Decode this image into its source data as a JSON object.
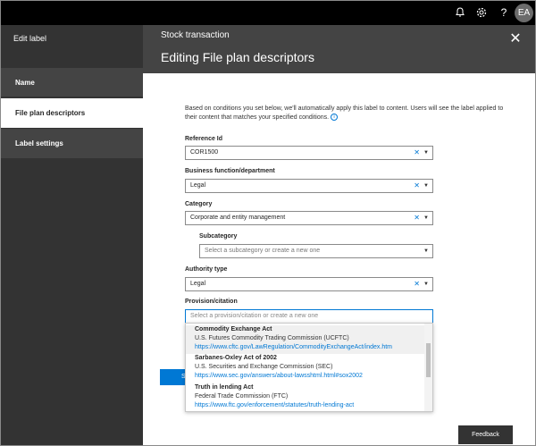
{
  "topbar": {
    "icons": [
      "bell-icon",
      "gear-icon",
      "help-icon"
    ],
    "help_glyph": "?",
    "avatar_initials": "EA"
  },
  "leftnav": {
    "title": "Edit label",
    "items": [
      {
        "label": "Name",
        "active": false
      },
      {
        "label": "File plan descriptors",
        "active": true
      },
      {
        "label": "Label settings",
        "active": false
      }
    ]
  },
  "header": {
    "subtitle": "Stock transaction",
    "title": "Editing File plan descriptors"
  },
  "description": "Based on conditions you set below, we'll automatically apply this label to content. Users will see the label applied to their content that matches your specified conditions.",
  "fields": {
    "reference_id": {
      "label": "Reference Id",
      "value": "COR1500"
    },
    "business_function": {
      "label": "Business function/department",
      "value": "Legal"
    },
    "category": {
      "label": "Category",
      "value": "Corporate and entity management"
    },
    "subcategory": {
      "label": "Subcategory",
      "placeholder": "Select a subcategory or create a new one"
    },
    "authority_type": {
      "label": "Authority type",
      "value": "Legal"
    },
    "provision": {
      "label": "Provision/citation",
      "placeholder": "Select a provision/citation or create a new one"
    }
  },
  "provision_options": [
    {
      "name": "Commodity Exchange Act",
      "agency": "U.S. Futures Commodity Trading Commission (UCFTC)",
      "url": "https://www.cftc.gov/LawRegulation/CommodityExchangeAct/index.htm"
    },
    {
      "name": "Sarbanes-Oxley Act of 2002",
      "agency": "U.S. Securities and Exchange Commission (SEC)",
      "url": "https://www.sec.gov/answers/about-lawsshtml.html#sox2002"
    },
    {
      "name": "Truth in lending Act",
      "agency": "Federal Trade Commission (FTC)",
      "url": "https://www.ftc.gov/enforcement/statutes/truth-lending-act"
    }
  ],
  "save_button_partial": "Sa",
  "feedback_label": "Feedback",
  "colors": {
    "accent": "#0078d4",
    "nav_bg": "#333333",
    "header_bg": "#444444",
    "topbar_bg": "#000000"
  }
}
